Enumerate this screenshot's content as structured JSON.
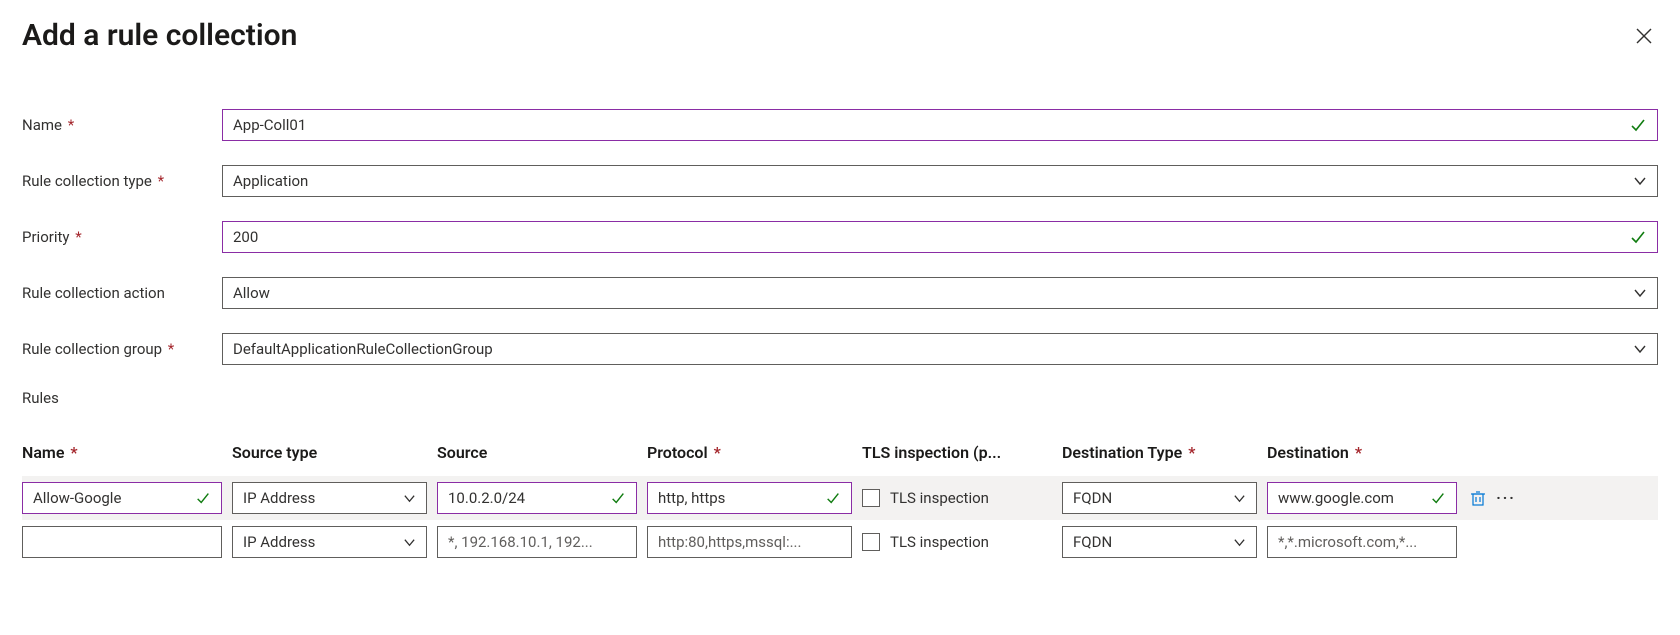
{
  "panel": {
    "title": "Add a rule collection"
  },
  "form": {
    "name_label": "Name",
    "name_value": "App-Coll01",
    "type_label": "Rule collection type",
    "type_value": "Application",
    "priority_label": "Priority",
    "priority_value": "200",
    "action_label": "Rule collection action",
    "action_value": "Allow",
    "group_label": "Rule collection group",
    "group_value": "DefaultApplicationRuleCollectionGroup",
    "rules_section_label": "Rules"
  },
  "required_marker": "*",
  "rules": {
    "columns": {
      "name": "Name",
      "source_type": "Source type",
      "source": "Source",
      "protocol": "Protocol",
      "tls": "TLS inspection (p...",
      "dest_type": "Destination Type",
      "destination": "Destination"
    },
    "rows": [
      {
        "name": "Allow-Google",
        "source_type": "IP Address",
        "source": "10.0.2.0/24",
        "protocol": "http, https",
        "tls_label": "TLS inspection",
        "dest_type": "FQDN",
        "destination": "www.google.com",
        "valid": true,
        "highlight": true,
        "show_actions": true
      },
      {
        "name": "",
        "source_type": "IP Address",
        "source": "",
        "source_placeholder": "*, 192.168.10.1, 192...",
        "protocol": "",
        "protocol_placeholder": "http:80,https,mssql:...",
        "tls_label": "TLS inspection",
        "dest_type": "FQDN",
        "destination": "",
        "destination_placeholder": "*,*.microsoft.com,*...",
        "valid": false,
        "highlight": false,
        "show_actions": false
      }
    ]
  }
}
